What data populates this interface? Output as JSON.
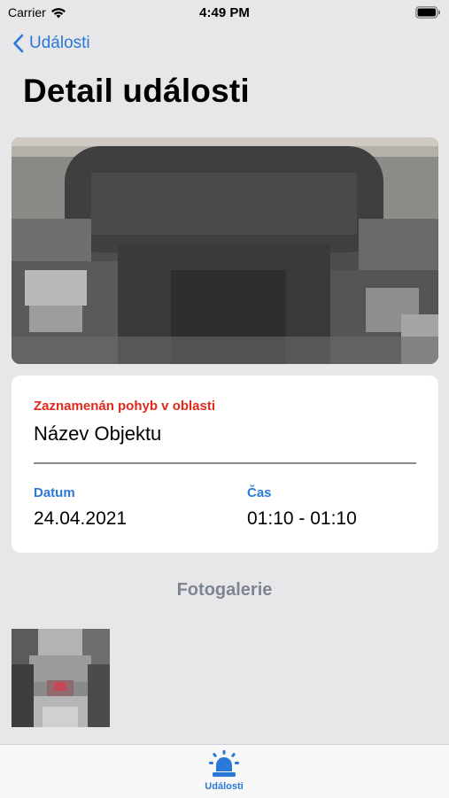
{
  "status_bar": {
    "carrier": "Carrier",
    "time": "4:49 PM"
  },
  "nav": {
    "back_label": "Události",
    "title": "Detail události"
  },
  "event": {
    "type_label": "Zaznamenán pohyb v oblasti",
    "object_name": "Název Objektu",
    "date_label": "Datum",
    "date_value": "24.04.2021",
    "time_label": "Čas",
    "time_value": "01:10 - 01:10"
  },
  "gallery": {
    "title": "Fotogalerie"
  },
  "tab_bar": {
    "items": [
      {
        "label": "Události",
        "icon": "alarm-light-icon",
        "selected": true
      }
    ]
  },
  "colors": {
    "accent": "#2a79d8",
    "alert": "#e0291c",
    "background": "#e7e7e9",
    "card": "#ffffff",
    "muted_heading": "#7d8591"
  }
}
